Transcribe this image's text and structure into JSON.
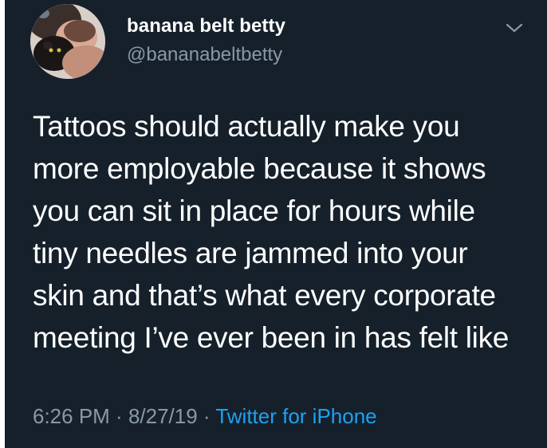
{
  "tweet": {
    "author": {
      "display_name": "banana belt betty",
      "handle": "@bananabeltbetty",
      "avatar_icon": "profile-photo"
    },
    "menu_icon": "chevron-down-icon",
    "text_lines": [
      "Tattoos should actually make you",
      "more employable because it shows",
      "you can sit in place for hours while",
      "tiny needles are jammed into your",
      "skin and that’s what every corporate",
      "meeting I’ve ever been in has felt like"
    ],
    "time": "6:26 PM",
    "separator": " · ",
    "date": "8/27/19",
    "source": "Twitter for iPhone"
  },
  "colors": {
    "background": "#15202b",
    "primary_text": "#ffffff",
    "secondary_text": "#8899a6",
    "link": "#1da1f2"
  }
}
